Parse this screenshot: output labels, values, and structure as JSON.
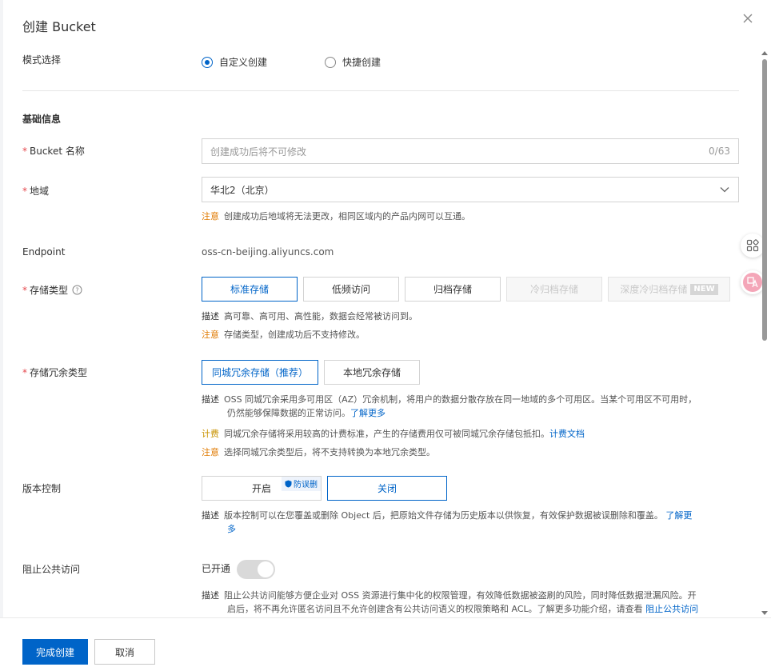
{
  "title": "创建 Bucket",
  "mode": {
    "label": "模式选择",
    "options": [
      "自定义创建",
      "快捷创建"
    ],
    "selected": "自定义创建"
  },
  "basic_info": "基础信息",
  "bucket_name": {
    "label": "Bucket 名称",
    "placeholder": "创建成功后将不可修改",
    "count": "0/63"
  },
  "region": {
    "label": "地域",
    "value": "华北2（北京）",
    "note_key": "注意",
    "note_text": "创建成功后地域将无法更改，相同区域内的产品内网可以互通。"
  },
  "endpoint": {
    "label": "Endpoint",
    "value": "oss-cn-beijing.aliyuncs.com"
  },
  "storage_class": {
    "label": "存储类型",
    "options": [
      "标准存储",
      "低频访问",
      "归档存储",
      "冷归档存储",
      "深度冷归档存储"
    ],
    "selected": "标准存储",
    "new_tag": "NEW",
    "desc_key": "描述",
    "desc_text": "高可靠、高可用、高性能，数据会经常被访问到。",
    "note_key": "注意",
    "note_text": "存储类型，创建成功后不支持修改。"
  },
  "redundancy": {
    "label": "存储冗余类型",
    "options": [
      "同城冗余存储（推荐）",
      "本地冗余存储"
    ],
    "selected": "同城冗余存储（推荐）",
    "desc_key": "描述",
    "desc_line1": "OSS 同城冗余采用多可用区（AZ）冗余机制，将用户的数据分散存放在同一地域的多个可用区。当某个可用区不可用时，",
    "desc_line2": "仍然能够保障数据的正常访问。",
    "desc_link": "了解更多",
    "fee_key": "计费",
    "fee_text": "同城冗余存储将采用较高的计费标准，产生的存储费用仅可被同城冗余存储包抵扣。",
    "fee_link": "计费文档",
    "note_key": "注意",
    "note_text": "选择同城冗余类型后，将不支持转换为本地冗余类型。"
  },
  "versioning": {
    "label": "版本控制",
    "on": "开启",
    "off": "关闭",
    "tag": "防误删",
    "selected": "关闭",
    "desc_key": "描述",
    "desc_text": "版本控制可以在您覆盖或删除 Object 后，把原始文件存储为历史版本以供恢复，有效保护数据被误删除和覆盖。",
    "link_part1": "了解更",
    "link_part2": "多"
  },
  "public_access": {
    "label": "阻止公共访问",
    "status": "已开通",
    "enabled": true,
    "desc_key": "描述",
    "desc_line1": "阻止公共访问能够方便企业对 OSS 资源进行集中化的权限管理，有效降低数据被盗刷的风险，同时降低数据泄漏风险。开",
    "desc_line2": "启后，将不再允许匿名访问且不允许创建含有公共访问语义的权限策略和 ACL。了解更多功能介绍，请查看",
    "desc_link": "阻止公共访问"
  },
  "footer": {
    "confirm": "完成创建",
    "cancel": "取消"
  },
  "colors": {
    "primary": "#0064c8",
    "warn": "#e07a00",
    "required": "#e5484d"
  },
  "icons": [
    "close-icon",
    "help-icon",
    "chevron-down-icon",
    "shield-icon",
    "apps-icon",
    "translate-icon"
  ]
}
